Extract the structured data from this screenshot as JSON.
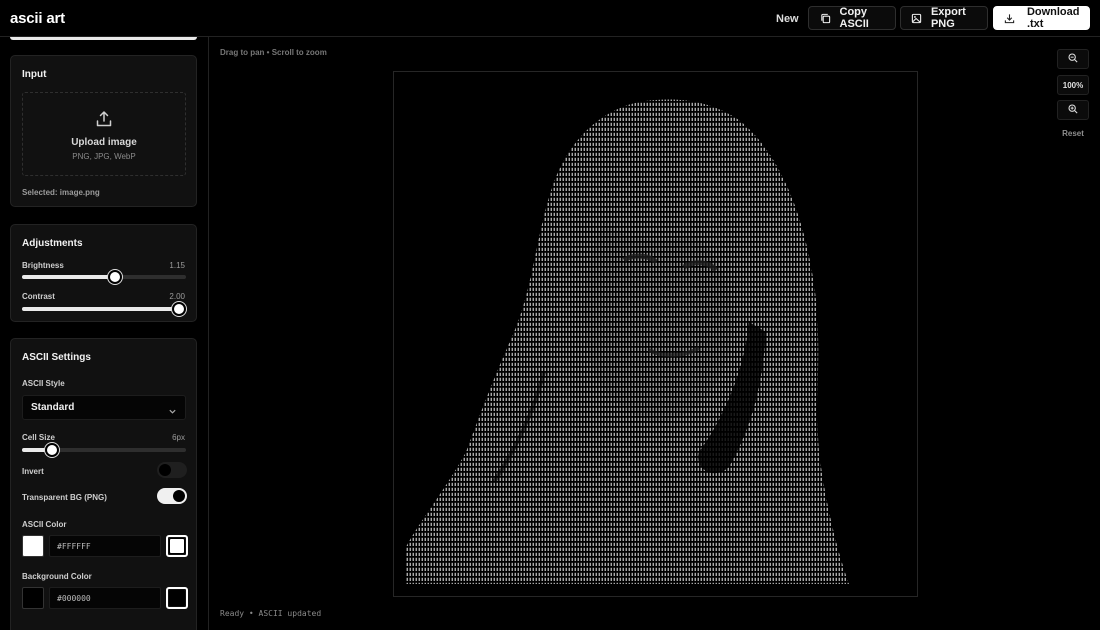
{
  "app": {
    "title": "ascii art"
  },
  "toolbar": {
    "new_label": "New",
    "copy_label": "Copy ASCII",
    "export_label": "Export PNG",
    "download_label": "Download .txt"
  },
  "input": {
    "title": "Input",
    "upload_title": "Upload image",
    "upload_formats": "PNG, JPG, WebP",
    "selected_file": "Selected: image.png"
  },
  "adjustments": {
    "title": "Adjustments",
    "brightness": {
      "label": "Brightness",
      "value_text": "1.15",
      "level": 0.575
    },
    "contrast": {
      "label": "Contrast",
      "value_text": "2.00",
      "level": 1.0
    }
  },
  "ascii_settings": {
    "title": "ASCII Settings",
    "style_label": "ASCII Style",
    "style_value": "Standard",
    "cell_size": {
      "label": "Cell Size",
      "value_text": "6px",
      "level": 0.15
    },
    "invert": {
      "label": "Invert",
      "on": false
    },
    "transparent_bg": {
      "label": "Transparent BG (PNG)",
      "on": true
    },
    "ascii_color": {
      "label": "ASCII Color",
      "hex": "#FFFFFF"
    },
    "background_color": {
      "label": "Background Color",
      "hex": "#000000"
    }
  },
  "canvas": {
    "hint": "Drag to pan • Scroll to zoom",
    "status": "Ready • ASCII updated",
    "zoom_level": "100%",
    "reset_label": "Reset"
  },
  "icons": {
    "copy": "copy-icon",
    "export": "image-icon",
    "download": "download-icon",
    "upload": "upload-icon",
    "zoom_out": "zoom-out-icon",
    "zoom_in": "zoom-in-icon",
    "chevron": "chevron-down-icon"
  }
}
